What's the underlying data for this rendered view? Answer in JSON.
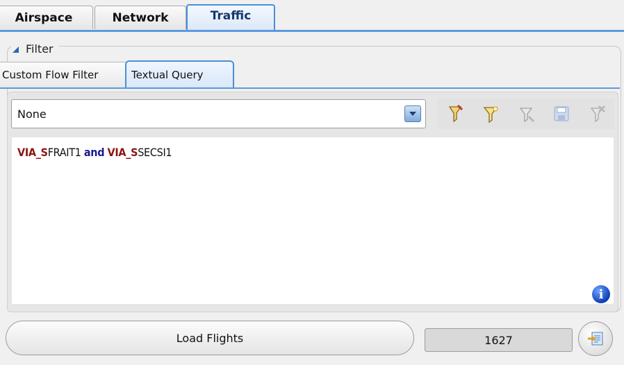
{
  "top_tabs": [
    "Airspace",
    "Network",
    "Traffic"
  ],
  "active_tab": "Traffic",
  "filter": {
    "title": "Filter"
  },
  "sub_tabs": [
    "Custom Flow Filter",
    "Textual Query"
  ],
  "active_sub_tab": "Textual Query",
  "query_selector": {
    "value": "None"
  },
  "query": {
    "parts": [
      {
        "text": "VIA_S",
        "style": "keyword"
      },
      {
        "text": "FRAIT1",
        "style": "plain"
      },
      {
        "text": "and",
        "style": "operator"
      },
      {
        "text": "VIA_S",
        "style": "keyword"
      },
      {
        "text": "SECSI1",
        "style": "plain"
      }
    ]
  },
  "toolbar_icons": [
    "new-filter-icon",
    "apply-filter-icon",
    "edit-filter-icon",
    "save-icon",
    "delete-filter-icon"
  ],
  "footer": {
    "load_label": "Load Flights",
    "flight_count": "1627"
  },
  "colors": {
    "accent": "#4b8ed6",
    "keyword": "#8b1414",
    "operator": "#1a1a8c"
  }
}
